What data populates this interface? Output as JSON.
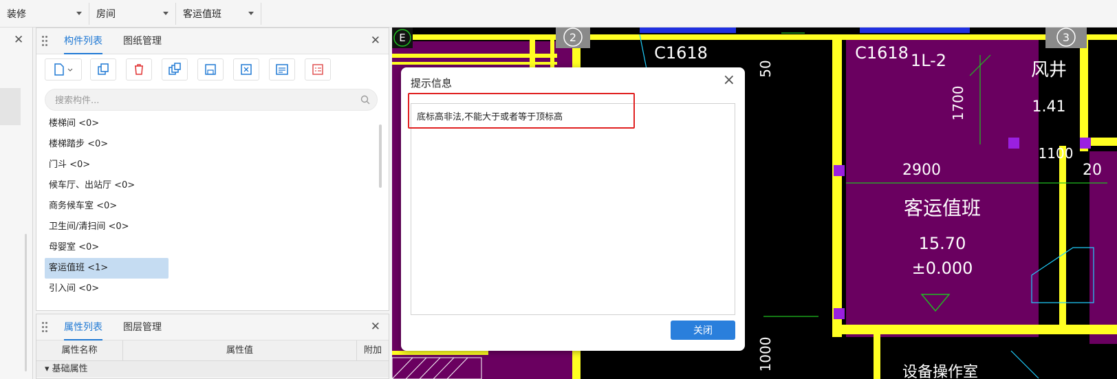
{
  "toolbar": {
    "dropdowns": [
      "装修",
      "房间",
      "客运值班"
    ]
  },
  "component_panel": {
    "tabs": [
      "构件列表",
      "图纸管理"
    ],
    "search_placeholder": "搜索构件...",
    "items": [
      "楼梯间 <0>",
      "楼梯踏步 <0>",
      "门斗 <0>",
      "候车厅、出站厅 <0>",
      "商务候车室 <0>",
      "卫生间/清扫间 <0>",
      "母婴室 <0>",
      "客运值班 <1>",
      "引入间 <0>"
    ],
    "selected_index": 7
  },
  "property_panel": {
    "tabs": [
      "属性列表",
      "图层管理"
    ],
    "columns": [
      "属性名称",
      "属性值",
      "附加"
    ],
    "group": "基础属性"
  },
  "dialog": {
    "title": "提示信息",
    "message": "底标高非法,不能大于或者等于顶标高",
    "close_button": "关闭"
  },
  "cad_labels": {
    "axis_e": "E",
    "axis_2": "2",
    "axis_3": "3",
    "win1": "C1618",
    "win2": "C1618",
    "dim_50": "50",
    "beam": "1L-2",
    "dim_1700": "1700",
    "shaft": "风井",
    "shaft_area": "1.41",
    "dim_1100": "1100",
    "dim_2900": "2900",
    "dim_20": "20",
    "room": "客运值班",
    "area": "15.70",
    "elev": "±0.000",
    "dim_1000": "1000",
    "room_bottom": "设备操作室"
  },
  "colors": {
    "accent": "#1e78d4",
    "wall": "#ffff22",
    "room_fill": "#6a0060",
    "highlight": "#e02020"
  }
}
